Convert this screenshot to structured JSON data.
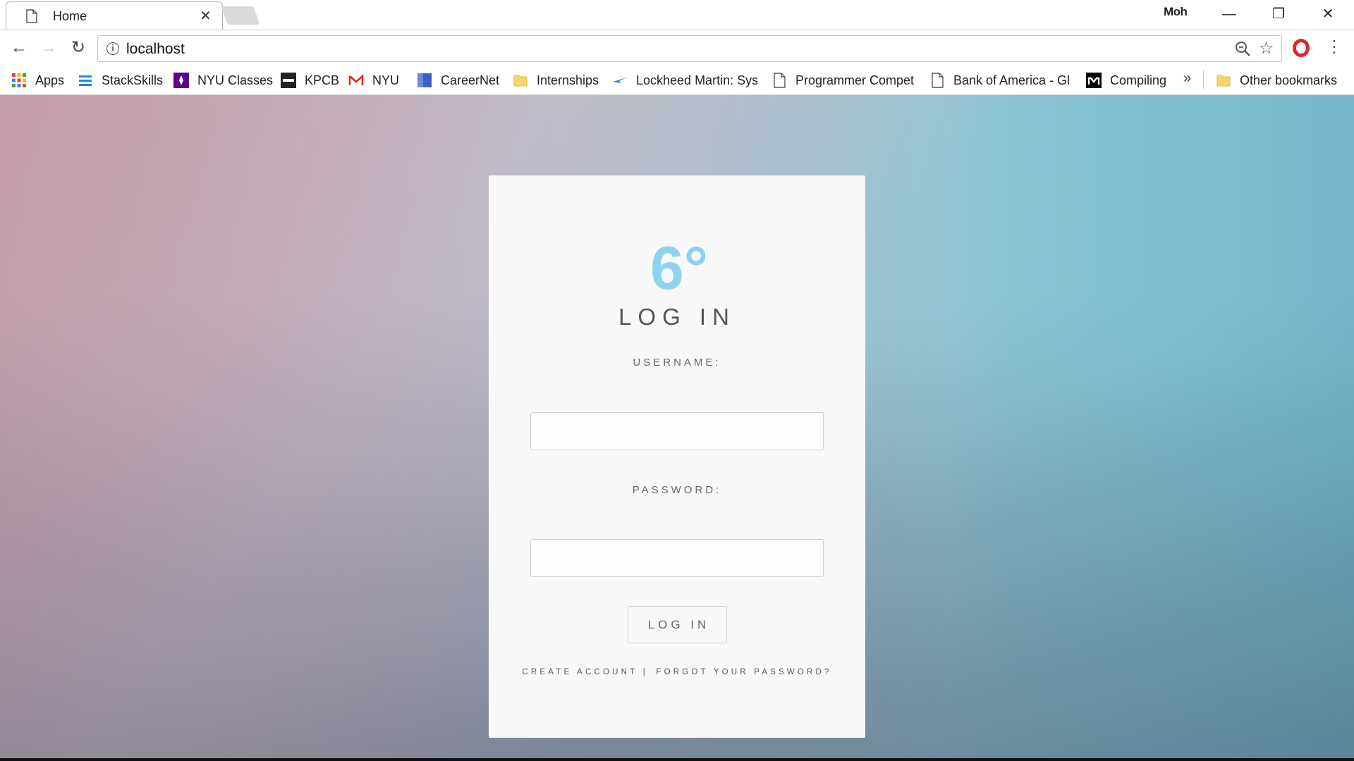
{
  "browser": {
    "tab_title": "Home",
    "tab_close": "✕",
    "profile_name": "Moh",
    "window_controls": {
      "minimize": "—",
      "restore": "❐",
      "close": "✕"
    },
    "url": "localhost",
    "more_bookmarks": "»",
    "bookmarks": [
      {
        "label": "Apps",
        "icon": "apps-grid-icon"
      },
      {
        "label": "StackSkills",
        "icon": "stackskills-icon"
      },
      {
        "label": "NYU Classes",
        "icon": "nyu-icon"
      },
      {
        "label": "KPCB",
        "icon": "kpcb-icon"
      },
      {
        "label": "NYU",
        "icon": "gmail-icon"
      },
      {
        "label": "CareerNet",
        "icon": "careernet-icon"
      },
      {
        "label": "Internships",
        "icon": "folder-icon"
      },
      {
        "label": "Lockheed Martin: Sys",
        "icon": "lockheed-icon"
      },
      {
        "label": "Programmer Compet",
        "icon": "page-icon"
      },
      {
        "label": "Bank of America - Gl",
        "icon": "page-icon"
      },
      {
        "label": "Compiling",
        "icon": "medium-icon"
      }
    ],
    "other_bookmarks": "Other bookmarks"
  },
  "login": {
    "logo_text": "6°",
    "title": "LOG IN",
    "username_label": "USERNAME:",
    "password_label": "PASSWORD:",
    "username_value": "",
    "password_value": "",
    "button_label": "LOG IN",
    "create_account": "CREATE ACCOUNT",
    "separator": "|",
    "forgot_password": "FORGOT YOUR PASSWORD?"
  },
  "colors": {
    "logo": "#8dd3ef",
    "card": "#f8f8f8",
    "gradient_left": "#d4b4bf",
    "gradient_right": "#8dd6e5"
  }
}
